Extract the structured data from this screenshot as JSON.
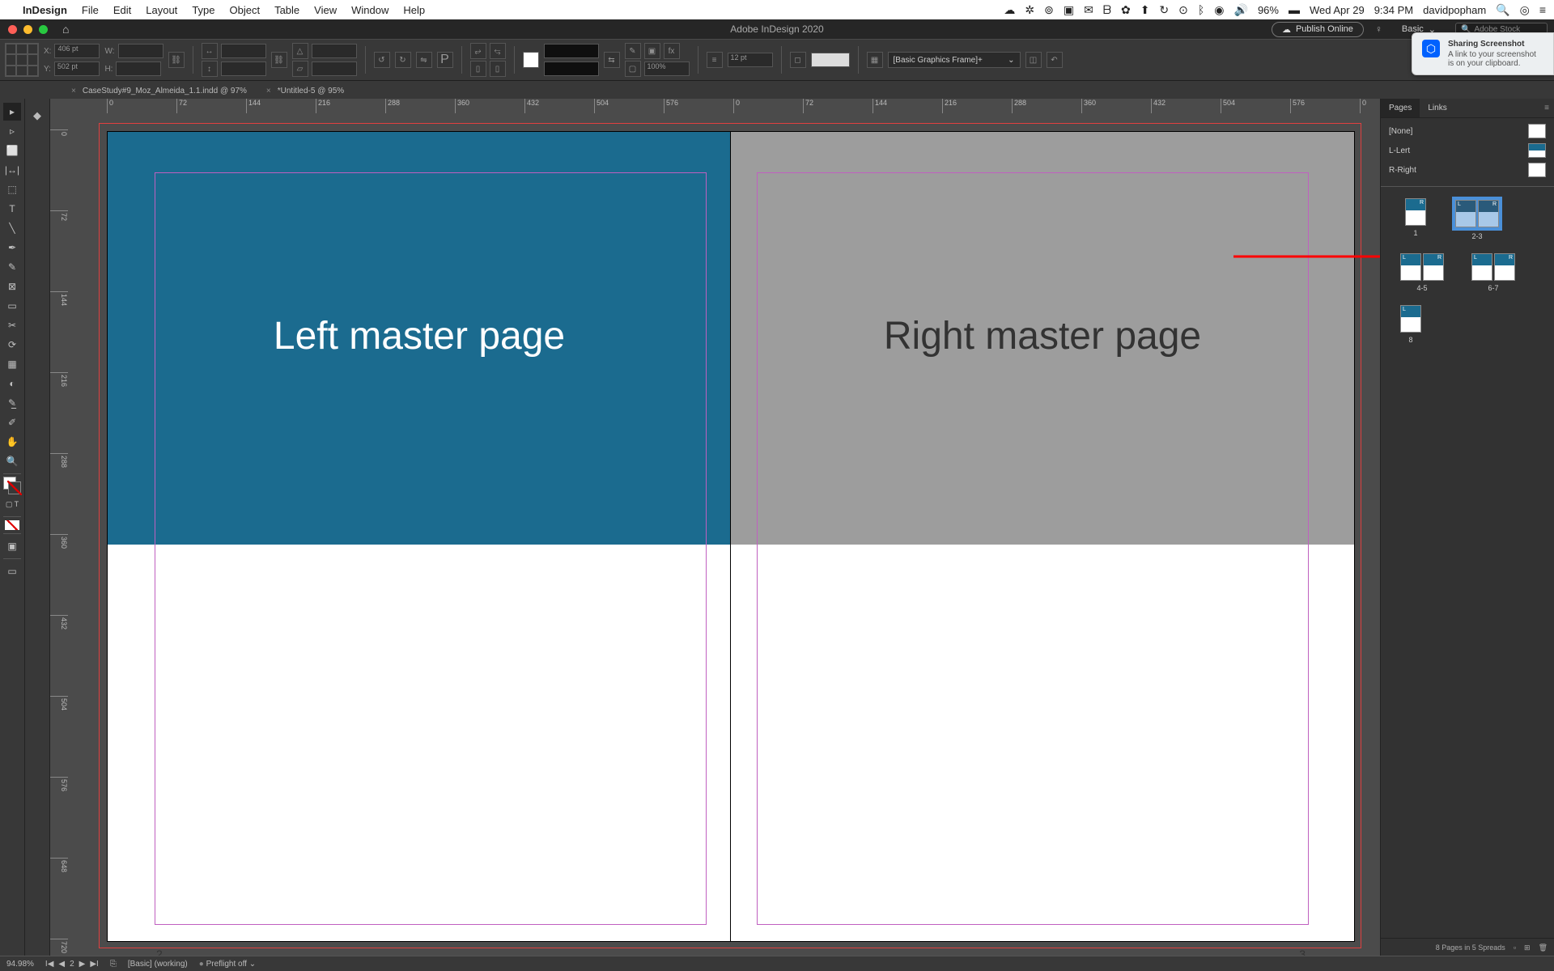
{
  "mac_menu": {
    "app": "InDesign",
    "items": [
      "File",
      "Edit",
      "Layout",
      "Type",
      "Object",
      "Table",
      "View",
      "Window",
      "Help"
    ],
    "status_right": {
      "battery_pct": "96%",
      "date": "Wed Apr 29",
      "time": "9:34 PM",
      "user": "davidpopham"
    }
  },
  "app_title": "Adobe InDesign 2020",
  "publish_label": "Publish Online",
  "workspace_label": "Basic",
  "stock_placeholder": "Adobe Stock",
  "controls": {
    "x_label": "X:",
    "x_val": "406 pt",
    "y_label": "Y:",
    "y_val": "502 pt",
    "w_label": "W:",
    "w_val": "",
    "h_label": "H:",
    "h_val": "",
    "stroke_label": "12 pt",
    "zoom_label": "100%",
    "style_name": "[Basic Graphics Frame]+"
  },
  "tabs": [
    {
      "label": "CaseStudy#9_Moz_Almeida_1.1.indd @ 97%"
    },
    {
      "label": "*Untitled-5 @ 95%"
    }
  ],
  "ruler_h": [
    "0",
    "72",
    "144",
    "216",
    "288",
    "360",
    "432",
    "504",
    "576",
    "0",
    "72",
    "144",
    "216",
    "288",
    "360",
    "432",
    "504",
    "576",
    "0"
  ],
  "ruler_v": [
    "0",
    "72",
    "144",
    "216",
    "288",
    "360",
    "432",
    "504",
    "576",
    "648",
    "720"
  ],
  "canvas": {
    "left_text": "Left master page",
    "right_text": "Right master page",
    "left_pgnum": "2",
    "right_pgnum": "3"
  },
  "pages_panel": {
    "tab1": "Pages",
    "tab2": "Links",
    "masters": [
      {
        "name": "[None]",
        "variant": "plain"
      },
      {
        "name": "L-Lert",
        "variant": "blue"
      },
      {
        "name": "R-Right",
        "variant": "plain"
      }
    ],
    "thumbs": [
      {
        "label": "1",
        "type": "single",
        "sel": false
      },
      {
        "label": "2-3",
        "type": "spread",
        "sel": true
      },
      {
        "label": "4-5",
        "type": "spread",
        "sel": false
      },
      {
        "label": "6-7",
        "type": "spread",
        "sel": false
      },
      {
        "label": "8",
        "type": "single",
        "sel": false
      }
    ],
    "footer": "8 Pages in 5 Spreads"
  },
  "statusbar": {
    "zoom": "94.98%",
    "page": "2",
    "status1": "[Basic] (working)",
    "status2": "Preflight off"
  },
  "notification": {
    "title": "Sharing Screenshot",
    "body": "A link to your screenshot is on your clipboard."
  }
}
